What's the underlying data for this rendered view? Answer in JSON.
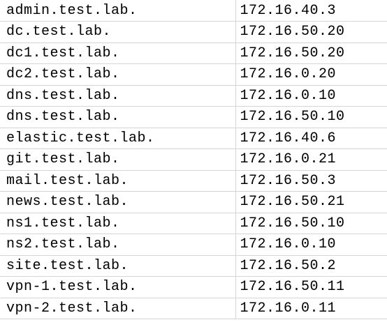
{
  "sheet": {
    "rows": [
      {
        "host": "admin.test.lab.",
        "ip": "172.16.40.3"
      },
      {
        "host": "dc.test.lab.",
        "ip": "172.16.50.20"
      },
      {
        "host": "dc1.test.lab.",
        "ip": "172.16.50.20"
      },
      {
        "host": "dc2.test.lab.",
        "ip": "172.16.0.20"
      },
      {
        "host": "dns.test.lab.",
        "ip": "172.16.0.10"
      },
      {
        "host": "dns.test.lab.",
        "ip": "172.16.50.10"
      },
      {
        "host": "elastic.test.lab.",
        "ip": "172.16.40.6"
      },
      {
        "host": "git.test.lab.",
        "ip": "172.16.0.21"
      },
      {
        "host": "mail.test.lab.",
        "ip": "172.16.50.3"
      },
      {
        "host": "news.test.lab.",
        "ip": "172.16.50.21"
      },
      {
        "host": "ns1.test.lab.",
        "ip": "172.16.50.10"
      },
      {
        "host": "ns2.test.lab.",
        "ip": "172.16.0.10"
      },
      {
        "host": "site.test.lab.",
        "ip": "172.16.50.2"
      },
      {
        "host": "vpn-1.test.lab.",
        "ip": "172.16.50.11"
      },
      {
        "host": "vpn-2.test.lab.",
        "ip": "172.16.0.11"
      }
    ]
  }
}
